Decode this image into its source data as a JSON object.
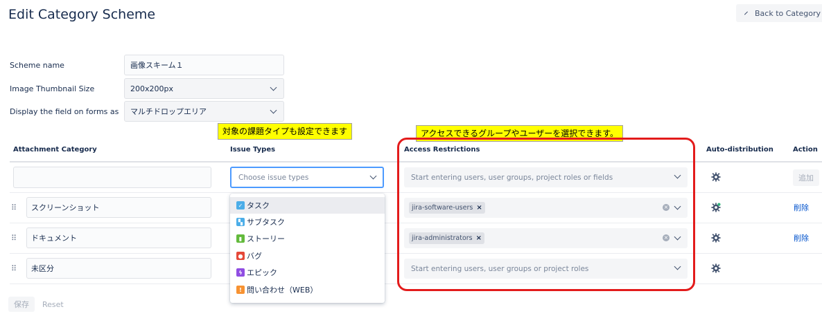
{
  "page": {
    "title": "Edit Category Scheme",
    "back_label": "Back to Category S"
  },
  "form": {
    "scheme_name_label": "Scheme name",
    "scheme_name_value": "画像スキーム１",
    "thumb_label": "Image Thumbnail Size",
    "thumb_value": "200x200px",
    "display_label": "Display the field on forms as",
    "display_value": "マルチドロップエリア"
  },
  "callouts": {
    "issue_types": "対象の課題タイプも設定できます",
    "access": "アクセスできるグループやユーザーを選択できます。"
  },
  "table": {
    "headers": {
      "category": "Attachment Category",
      "issue_types": "Issue Types",
      "access": "Access Restrictions",
      "auto": "Auto-distribution",
      "action": "Action"
    },
    "new_row": {
      "issue_placeholder": "Choose issue types",
      "access_placeholder": "Start entering users, user groups, project roles or fields",
      "add_label": "追加"
    },
    "rows": [
      {
        "name": "スクリーンショット",
        "tag": "jira-software-users",
        "delete_label": "削除",
        "auto_active": true
      },
      {
        "name": "ドキュメント",
        "tag": "jira-administrators",
        "delete_label": "削除",
        "auto_active": false
      },
      {
        "name": "未区分",
        "access_placeholder": "Start entering users, user groups or project roles",
        "auto_active": false
      }
    ]
  },
  "dropdown": {
    "options": [
      {
        "label": "タスク",
        "icon": "task-icon",
        "color": "#4bade8",
        "selected": true
      },
      {
        "label": "サブタスク",
        "icon": "subtask-icon",
        "color": "#4bade8"
      },
      {
        "label": "ストーリー",
        "icon": "story-icon",
        "color": "#63ba3c"
      },
      {
        "label": "バグ",
        "icon": "bug-icon",
        "color": "#e5493a"
      },
      {
        "label": "エピック",
        "icon": "epic-icon",
        "color": "#904ee2"
      },
      {
        "label": "問い合わせ（WEB）",
        "icon": "inquiry-icon",
        "color": "#f79232"
      }
    ]
  },
  "footer": {
    "save_label": "保存",
    "reset_label": "Reset"
  }
}
